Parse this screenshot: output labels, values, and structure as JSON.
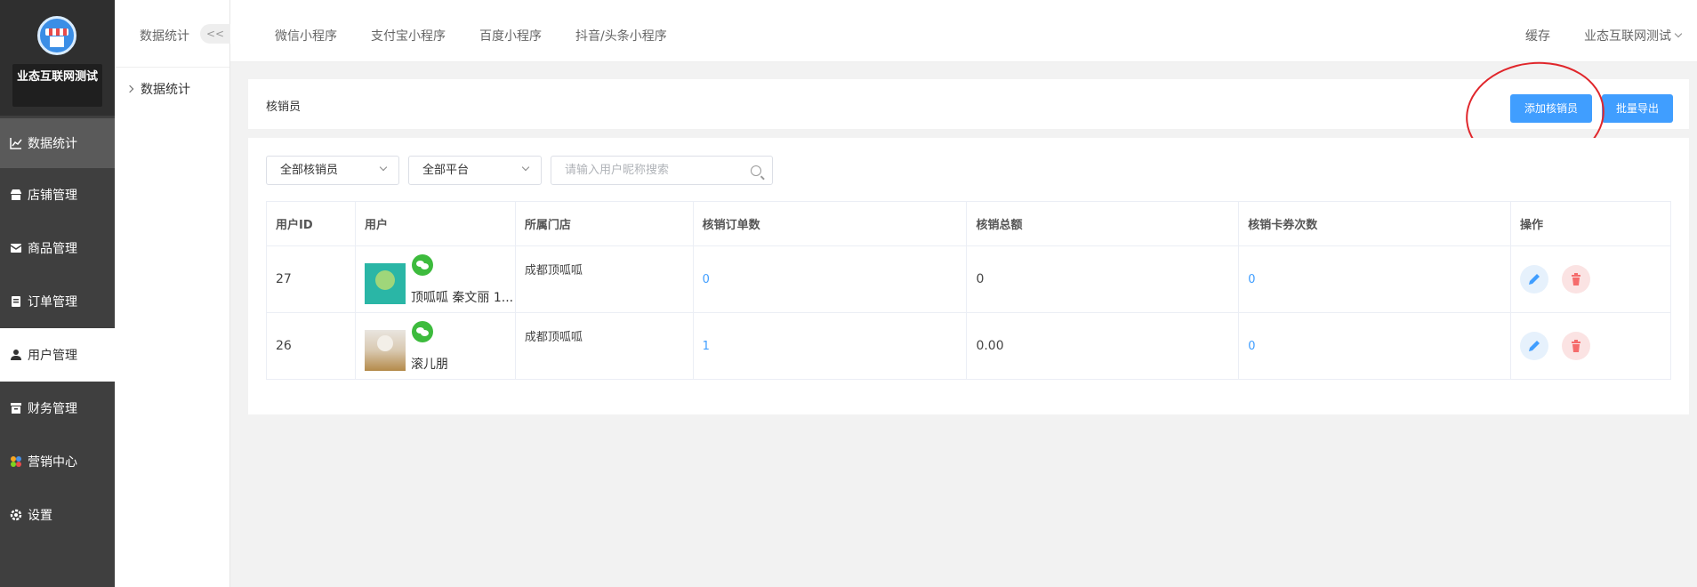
{
  "brand": {
    "name": "业态互联网测试"
  },
  "menu": [
    {
      "label": "数据统计",
      "icon": "chart-line-icon"
    },
    {
      "label": "店铺管理",
      "icon": "shop-icon"
    },
    {
      "label": "商品管理",
      "icon": "goods-icon"
    },
    {
      "label": "订单管理",
      "icon": "order-icon"
    },
    {
      "label": "用户管理",
      "icon": "user-icon"
    },
    {
      "label": "财务管理",
      "icon": "finance-icon"
    },
    {
      "label": "营销中心",
      "icon": "marketing-icon"
    },
    {
      "label": "设置",
      "icon": "gear-icon"
    }
  ],
  "subnav": {
    "title": "数据统计",
    "collapse": "<<",
    "item": "数据统计"
  },
  "topbar": {
    "tabs": [
      "微信小程序",
      "支付宝小程序",
      "百度小程序",
      "抖音/头条小程序"
    ],
    "cache": "缓存",
    "user": "业态互联网测试"
  },
  "header": {
    "title": "核销员",
    "add_button": "添加核销员",
    "export_button": "批量导出"
  },
  "filters": {
    "staff_select": "全部核销员",
    "platform_select": "全部平台",
    "search_placeholder": "请输入用户昵称搜索"
  },
  "table": {
    "columns": [
      "用户ID",
      "用户",
      "所属门店",
      "核销订单数",
      "核销总额",
      "核销卡券次数",
      "操作"
    ],
    "rows": [
      {
        "id": "27",
        "user": "顶呱呱 秦文丽 1...",
        "store": "成都顶呱呱",
        "orders": "0",
        "total": "0",
        "coupons": "0"
      },
      {
        "id": "26",
        "user": "滚儿朋",
        "store": "成都顶呱呱",
        "orders": "1",
        "total": "0.00",
        "coupons": "0"
      }
    ]
  },
  "colors": {
    "accent": "#409eff",
    "sidebar": "#3f3f3f",
    "danger": "#f56c6c",
    "annotation": "#e0262b"
  }
}
